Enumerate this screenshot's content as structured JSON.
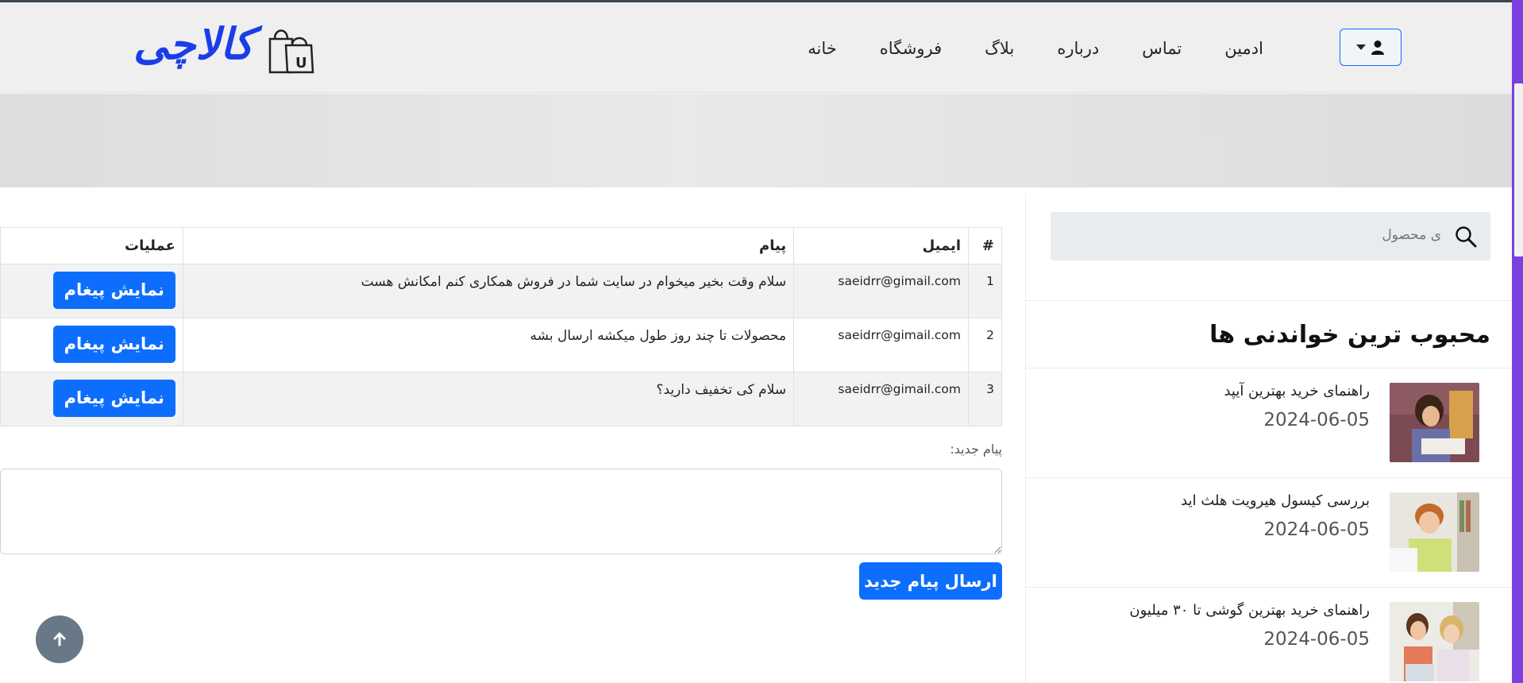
{
  "brand": {
    "logo_text": "کالاچی",
    "bag_letter": "U",
    "accent_color": "#0d6efd",
    "logo_color": "#1a3de8"
  },
  "nav": {
    "items": [
      {
        "label": "خانه"
      },
      {
        "label": "فروشگاه"
      },
      {
        "label": "بلاگ"
      },
      {
        "label": "درباره"
      },
      {
        "label": "تماس"
      },
      {
        "label": "ادمین"
      }
    ],
    "user_menu_icon": "user-icon"
  },
  "table": {
    "headers": {
      "index": "#",
      "email": "ایمیل",
      "message": "پیام",
      "actions": "عملیات"
    },
    "rows": [
      {
        "index": "1",
        "email": "saeidrr@gimail.com",
        "message": "سلام وقت بخیر میخوام در سایت شما در فروش همکاری کنم امکانش هست",
        "action_label": "نمایش پیغام"
      },
      {
        "index": "2",
        "email": "saeidrr@gimail.com",
        "message": "محصولات تا چند روز طول میکشه ارسال بشه",
        "action_label": "نمایش پیغام"
      },
      {
        "index": "3",
        "email": "saeidrr@gimail.com",
        "message": "سلام کی تخفیف دارید؟",
        "action_label": "نمایش پیغام"
      }
    ]
  },
  "new_message": {
    "label": "پیام جدید:",
    "value": "",
    "send_label": "ارسال پیام جدید"
  },
  "sidebar": {
    "search": {
      "placeholder": "ی محصول"
    },
    "title": "محبوب ترین خواندنی ها",
    "posts": [
      {
        "title": "راهنمای خرید بهترین آیپد",
        "date": "2024-06-05"
      },
      {
        "title": "بررسی کیسول هیرویت هلث اید",
        "date": "2024-06-05"
      },
      {
        "title": "راهنمای خرید بهترین گوشی تا ۳۰ میلیون",
        "date": "2024-06-05"
      }
    ]
  }
}
